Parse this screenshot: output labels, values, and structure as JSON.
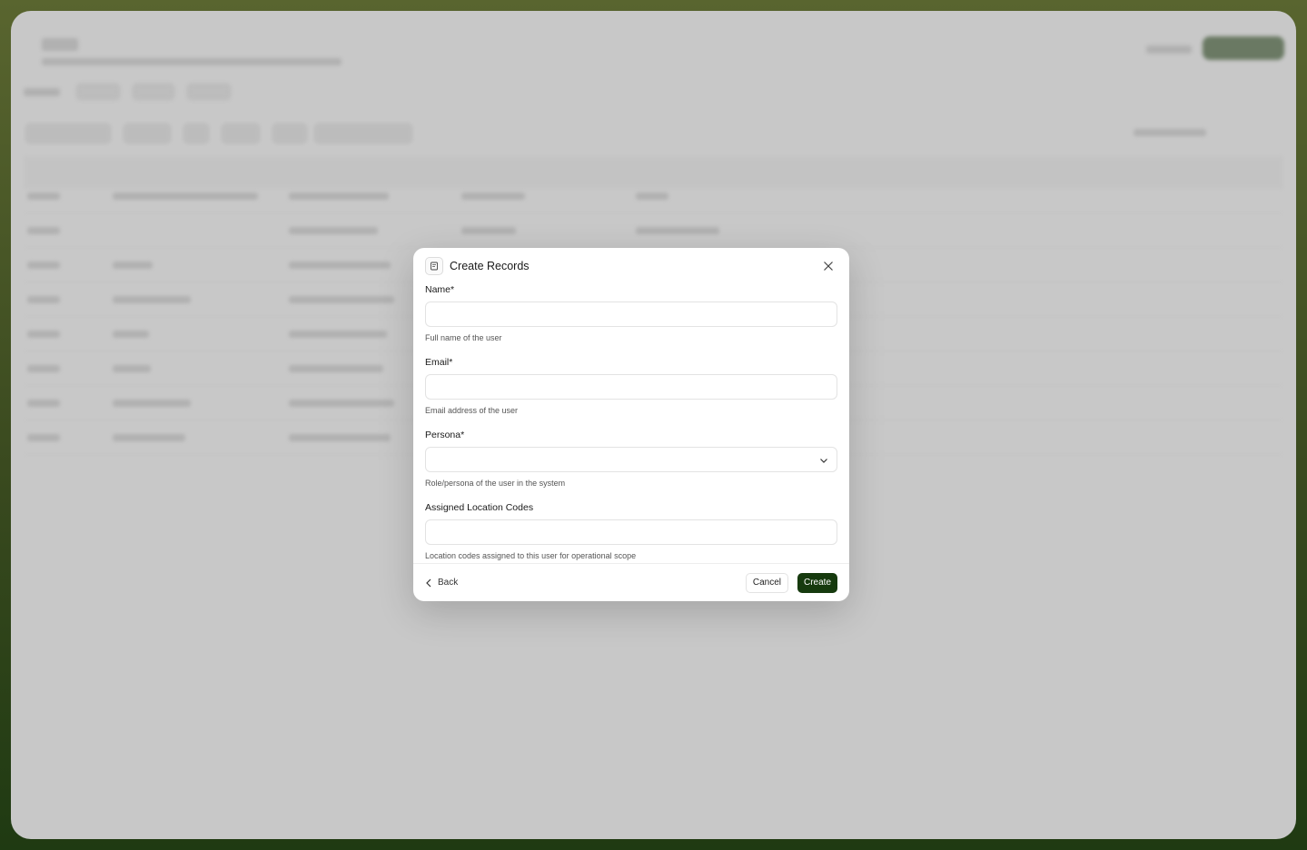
{
  "modal": {
    "title": "Create Records",
    "icon": "form-icon",
    "close_icon": "close-icon",
    "fields": [
      {
        "label": "Name*",
        "value": "",
        "help": "Full name of the user",
        "type": "text"
      },
      {
        "label": "Email*",
        "value": "",
        "help": "Email address of the user",
        "type": "text"
      },
      {
        "label": "Persona*",
        "value": "",
        "help": "Role/persona of the user in the system",
        "type": "select"
      },
      {
        "label": "Assigned Location Codes",
        "value": "",
        "help": "Location codes assigned to this user for operational scope",
        "type": "text"
      }
    ],
    "footer": {
      "back_label": "Back",
      "cancel_label": "Cancel",
      "create_label": "Create"
    }
  },
  "colors": {
    "primary": "#163a0e",
    "overlay": "#c8c8c8",
    "frame_top": "#59652f",
    "frame_bottom": "#1f3a12"
  }
}
